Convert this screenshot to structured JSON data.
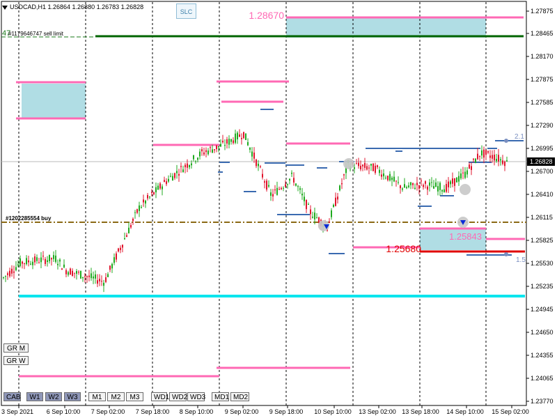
{
  "header": {
    "symbol_info": "USDCAD,H1  1.26864 1.26880 1.26783 1.26828",
    "slc_button": "SLC"
  },
  "price_axis": {
    "ticks": [
      "1.27875",
      "1.28465",
      "1.28170",
      "1.27875",
      "1.27585",
      "1.27290",
      "1.26995",
      "1.26700",
      "1.26410",
      "1.26115",
      "1.25825",
      "1.25530",
      "1.25235",
      "1.24945",
      "1.24650",
      "1.24355",
      "1.24065",
      "1.23770"
    ],
    "current_price": "1.26828",
    "current_price_bg": "#000000"
  },
  "time_axis": {
    "labels": [
      "3 Sep 2021",
      "6 Sep 10:00",
      "7 Sep 02:00",
      "7 Sep 18:00",
      "8 Sep 10:00",
      "9 Sep 02:00",
      "9 Sep 18:00",
      "10 Sep 10:00",
      "13 Sep 02:00",
      "13 Sep 18:00",
      "14 Sep 10:00",
      "15 Sep 02:00"
    ]
  },
  "annotations": {
    "sell_limit": "#1179646747 sell limit",
    "sell_limit_prefix": "47",
    "buy_order": "#1202285554 buy",
    "zone_price_top": "1.28670",
    "zone_price_mid": "1.25843",
    "zone_price_red": "1.25680",
    "right_label_top": "2.1",
    "right_label_bottom": "1.5"
  },
  "buttons": {
    "gr_m": "GR M",
    "gr_w": "GR W",
    "timeframes": [
      "CAB",
      "W1",
      "W2",
      "W3",
      "M1",
      "M2",
      "M3",
      "WD1",
      "WD2",
      "WD3",
      "MD1",
      "MD2"
    ]
  },
  "colors": {
    "bull": "#1faa1f",
    "bear": "#e0142c",
    "pink": "#ff69b4",
    "cyan": "#00e5ee",
    "zone": "#b0dde4",
    "green_line": "#006400",
    "red_line": "#e00000",
    "olive": "#8b6914",
    "blue_line": "#3a6ab0"
  }
}
